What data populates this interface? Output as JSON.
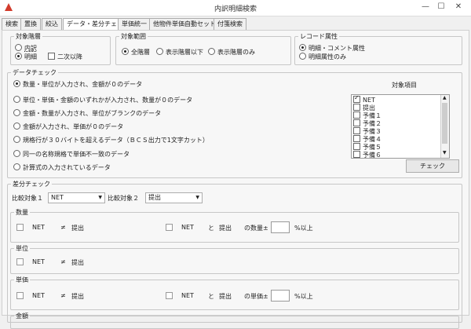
{
  "window": {
    "title": "内訳明細検索",
    "minimize": "—",
    "maximize": "☐",
    "close": "✕"
  },
  "tabs": [
    "検索",
    "置換",
    "絞込",
    "データ・差分チェック",
    "単価統一",
    "他物件単価自動セット",
    "付箋検索"
  ],
  "target_level": {
    "legend": "対象階層",
    "option1": "内訳",
    "option2": "明細",
    "checkbox": "二次以降"
  },
  "target_range": {
    "legend": "対象範囲",
    "options": [
      "全階層",
      "表示階層以下",
      "表示階層のみ"
    ]
  },
  "record_attr": {
    "legend": "レコード属性",
    "options": [
      "明細・コメント属性",
      "明細属性のみ"
    ]
  },
  "data_check": {
    "legend": "データチェック",
    "options": [
      "数量・単位が入力され、金額が０のデータ",
      "単位・単価・金額のいずれかが入力され、数量が０のデータ",
      "金額・数量が入力され、単位がブランクのデータ",
      "金額が入力され、単価が０のデータ",
      "規格行が３０バイトを超えるデータ（ＢＣＳ出力で1文字カット）",
      "同一の名称規格で単価不一致のデータ",
      "計算式の入力されているデータ"
    ],
    "items_label": "対象項目",
    "items": [
      "NET",
      "提出",
      "予備１",
      "予備２",
      "予備３",
      "予備４",
      "予備５",
      "予備６"
    ],
    "check_button": "チェック"
  },
  "diff_check": {
    "legend": "差分チェック",
    "compare1_label": "比較対象１",
    "compare1_value": "NET",
    "compare2_label": "比較対象２",
    "compare2_value": "提出",
    "quantity": {
      "legend": "数量",
      "left_a": "NET",
      "left_op": "≠",
      "left_b": "提出",
      "right_a": "NET",
      "right_and": "と",
      "right_b": "提出",
      "right_label": "の数量±",
      "pct": "%以上"
    },
    "unit": {
      "legend": "単位",
      "left_a": "NET",
      "left_op": "≠",
      "left_b": "提出"
    },
    "price": {
      "legend": "単価",
      "left_a": "NET",
      "left_op": "≠",
      "left_b": "提出",
      "right_a": "NET",
      "right_and": "と",
      "right_b": "提出",
      "right_label": "の単価±",
      "pct": "%以上"
    },
    "amount": {
      "legend": "金額"
    }
  }
}
